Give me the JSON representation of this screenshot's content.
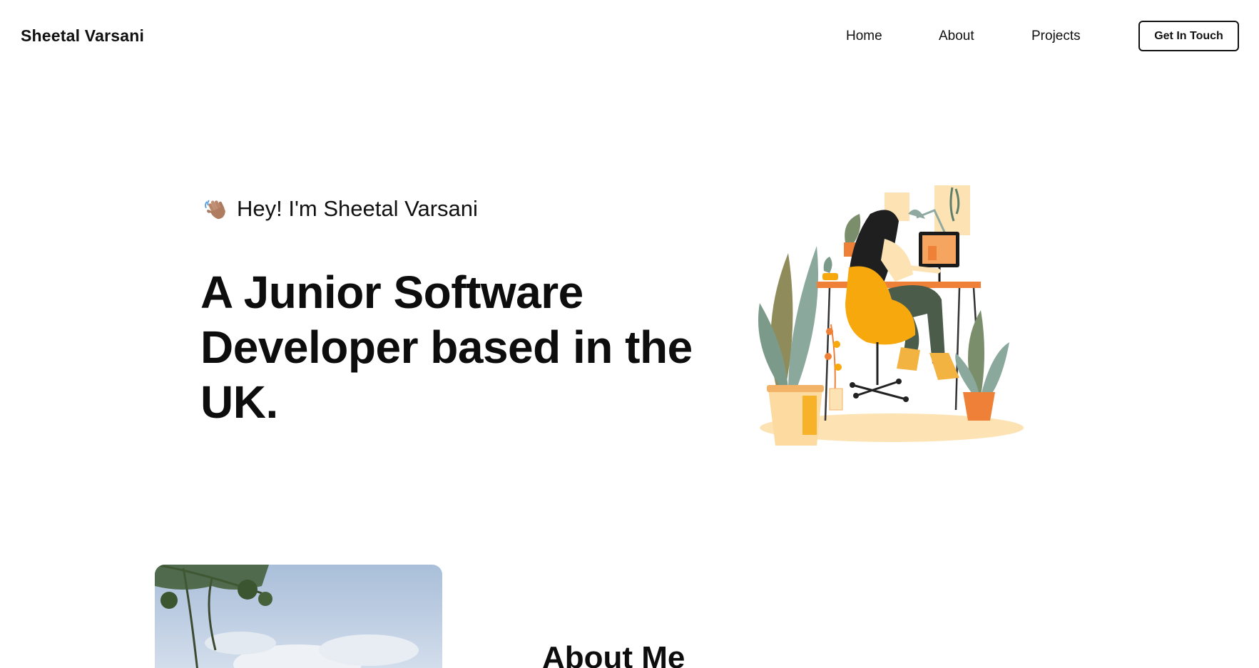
{
  "nav": {
    "brand": "Sheetal Varsani",
    "links": [
      {
        "label": "Home"
      },
      {
        "label": "About"
      },
      {
        "label": "Projects"
      }
    ],
    "cta_label": "Get In Touch"
  },
  "hero": {
    "greeting": "Hey! I'm Sheetal Varsani",
    "greeting_icon": "waving-hand-icon",
    "headline": "A Junior Software Developer based in the UK.",
    "illustration": "woman-at-desk-illustration"
  },
  "about": {
    "title": "About Me",
    "photo": "sky-and-tree-photo"
  },
  "colors": {
    "text": "#111111",
    "background": "#ffffff",
    "accent_yellow": "#f6a80d",
    "accent_orange": "#ee8038",
    "plant_green": "#8aa89c"
  }
}
